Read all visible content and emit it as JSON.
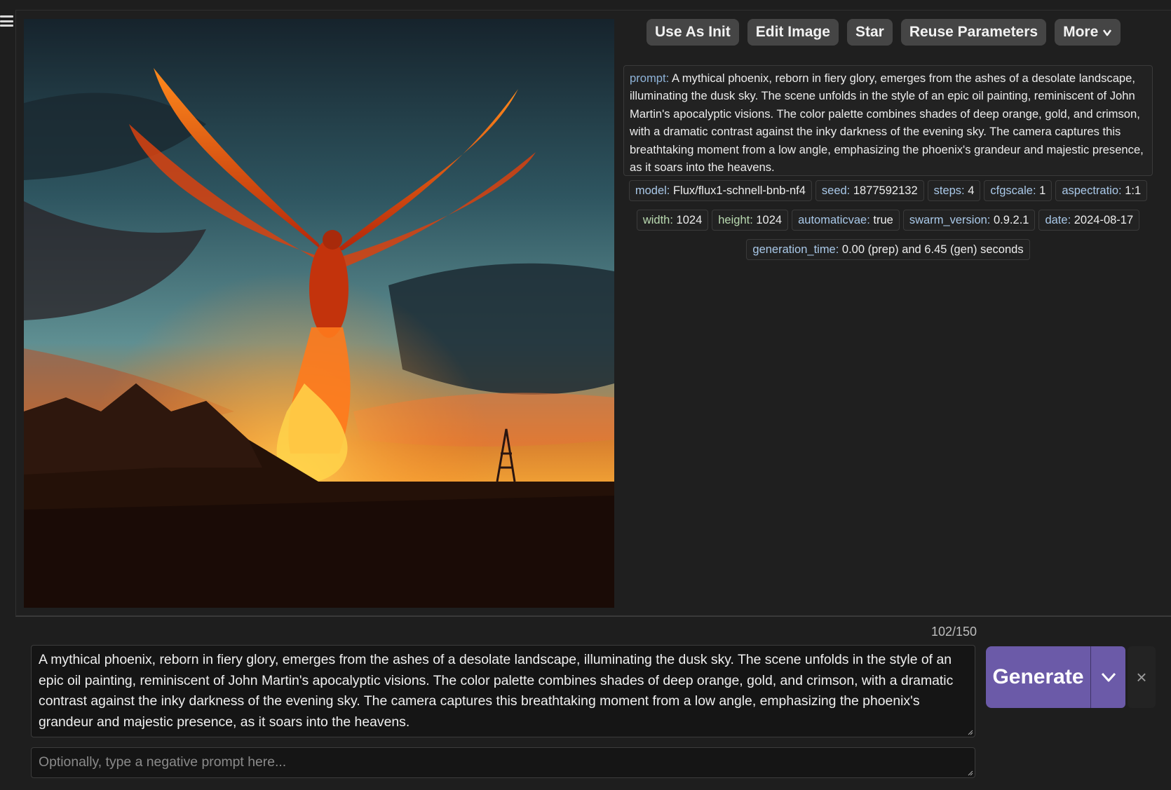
{
  "toolbar": {
    "use_as_init": "Use As Init",
    "edit_image": "Edit Image",
    "star": "Star",
    "reuse_parameters": "Reuse Parameters",
    "more": "More"
  },
  "metadata": {
    "prompt_key": "prompt:",
    "prompt_value": " A mythical phoenix, reborn in fiery glory, emerges from the ashes of a desolate landscape, illuminating the dusk sky. The scene unfolds in the style of an epic oil painting, reminiscent of John Martin's apocalyptic visions. The color palette combines shades of deep orange, gold, and crimson, with a dramatic contrast against the inky darkness of the evening sky. The camera captures this breathtaking moment from a low angle, emphasizing the phoenix's grandeur and majestic presence, as it soars into the heavens.",
    "tags": [
      {
        "key": "model:",
        "value": " Flux/flux1-schnell-bnb-nf4"
      },
      {
        "key": "seed:",
        "value": " 1877592132"
      },
      {
        "key": "steps:",
        "value": " 4"
      },
      {
        "key": "cfgscale:",
        "value": " 1"
      },
      {
        "key": "aspectratio:",
        "value": " 1:1"
      },
      {
        "key": "width:",
        "value": " 1024"
      },
      {
        "key": "height:",
        "value": " 1024"
      },
      {
        "key": "automaticvae:",
        "value": " true"
      },
      {
        "key": "swarm_version:",
        "value": " 0.9.2.1"
      },
      {
        "key": "date:",
        "value": " 2024-08-17"
      },
      {
        "key": "generation_time:",
        "value": " 0.00 (prep) and 6.45 (gen) seconds"
      }
    ]
  },
  "prompt": {
    "token_count": "102/150",
    "value": "A mythical phoenix, reborn in fiery glory, emerges from the ashes of a desolate landscape, illuminating the dusk sky. The scene unfolds in the style of an epic oil painting, reminiscent of John Martin's apocalyptic visions. The color palette combines shades of deep orange, gold, and crimson, with a dramatic contrast against the inky darkness of the evening sky. The camera captures this breathtaking moment from a low angle, emphasizing the phoenix's grandeur and majestic presence, as it soars into the heavens.",
    "negative_placeholder": "Optionally, type a negative prompt here..."
  },
  "generate": {
    "label": "Generate",
    "close": "×"
  },
  "colors": {
    "background": "#1e1e1e",
    "button": "#454545",
    "generate": "#6b5aa8"
  }
}
